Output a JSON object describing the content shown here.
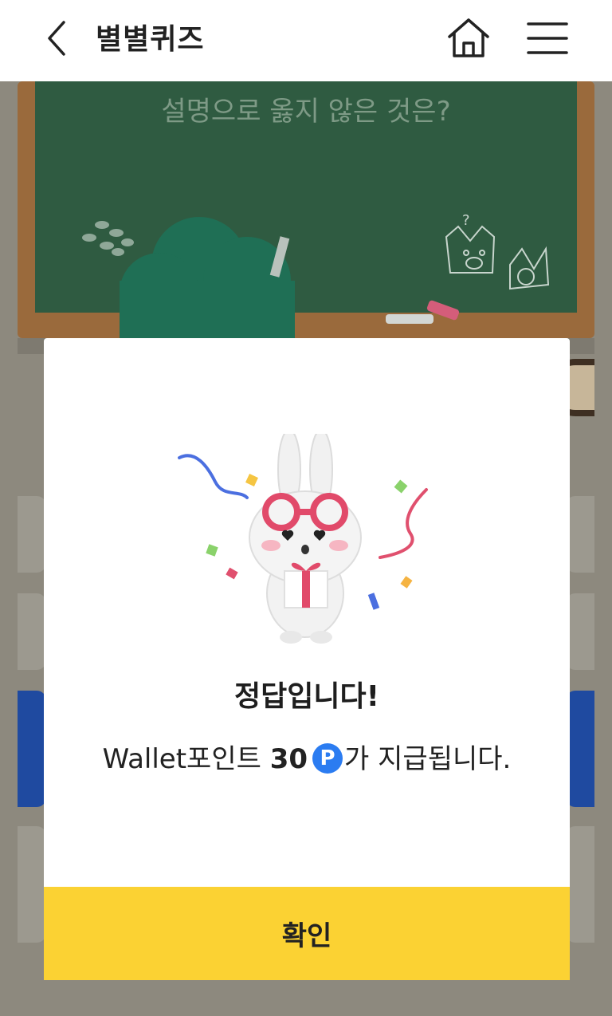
{
  "header": {
    "title": "별별퀴즈",
    "back_icon": "chevron-left-icon",
    "home_icon": "home-icon",
    "menu_icon": "hamburger-menu-icon"
  },
  "quiz": {
    "question": "설명으로 옳지 않은 것은?"
  },
  "modal": {
    "result_title": "정답입니다!",
    "reward_prefix": "Wallet포인트 ",
    "reward_points": "30",
    "point_badge": "P",
    "reward_suffix": "가 지급됩니다.",
    "confirm_label": "확인"
  },
  "colors": {
    "accent_yellow": "#fbd233",
    "point_blue": "#2b7cf1",
    "chalkboard": "#2f5b41",
    "answer_selected": "#1f4aa0"
  }
}
